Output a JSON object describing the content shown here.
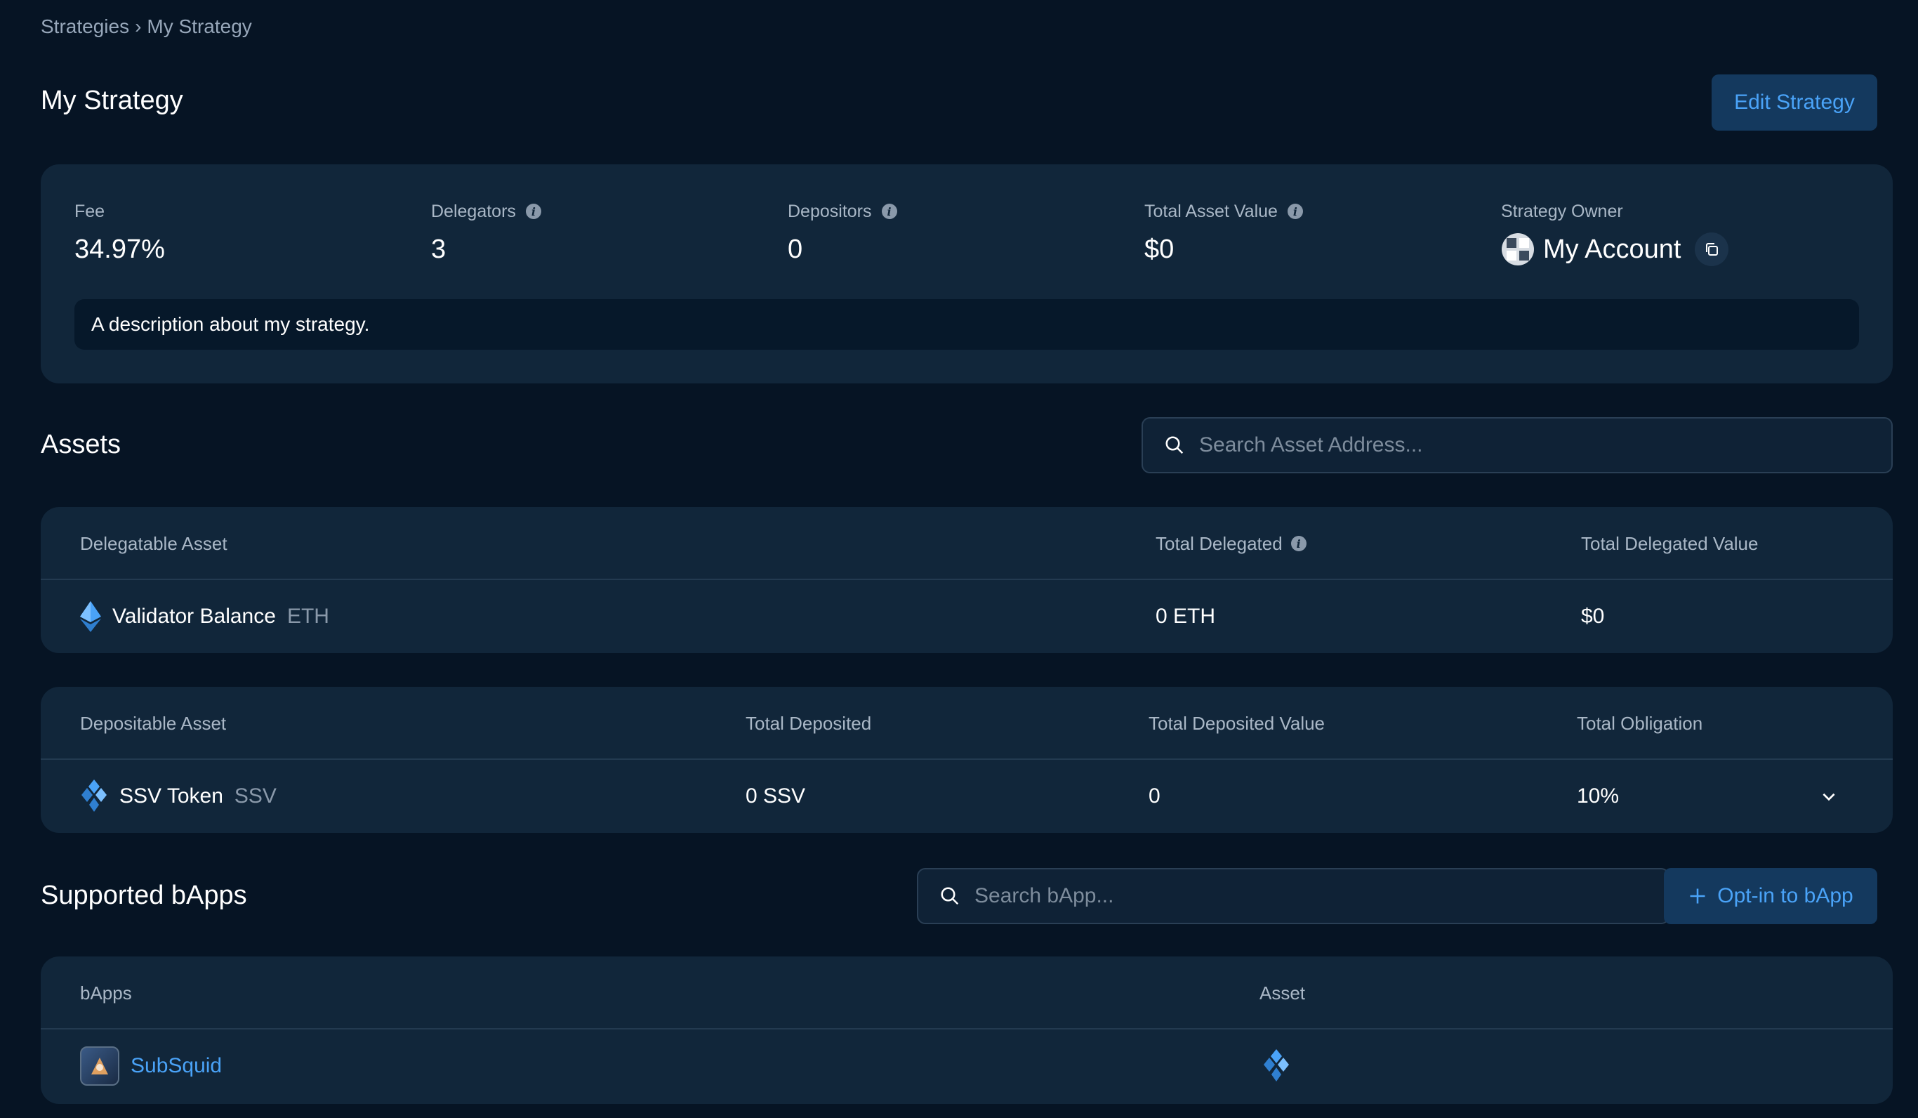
{
  "breadcrumb": {
    "root": "Strategies",
    "separator": "›",
    "current": "My Strategy"
  },
  "header": {
    "title": "My Strategy",
    "edit_label": "Edit Strategy"
  },
  "stats": {
    "fee": {
      "label": "Fee",
      "value": "34.97%"
    },
    "delegators": {
      "label": "Delegators",
      "value": "3"
    },
    "depositors": {
      "label": "Depositors",
      "value": "0"
    },
    "total_asset_value": {
      "label": "Total Asset Value",
      "value": "$0"
    },
    "owner": {
      "label": "Strategy Owner",
      "value": "My Account"
    }
  },
  "description": "A description about my strategy.",
  "assets": {
    "title": "Assets",
    "search_placeholder": "Search Asset Address...",
    "delegatable": {
      "headers": [
        "Delegatable Asset",
        "Total Delegated",
        "Total Delegated Value"
      ],
      "rows": [
        {
          "name": "Validator Balance",
          "ticker": "ETH",
          "total": "0 ETH",
          "value": "$0"
        }
      ]
    },
    "depositable": {
      "headers": [
        "Depositable Asset",
        "Total Deposited",
        "Total Deposited Value",
        "Total Obligation"
      ],
      "rows": [
        {
          "name": "SSV Token",
          "ticker": "SSV",
          "total": "0 SSV",
          "value": "0",
          "obligation": "10%"
        }
      ]
    }
  },
  "bapps": {
    "title": "Supported bApps",
    "search_placeholder": "Search bApp...",
    "optin_label": "Opt-in to bApp",
    "headers": [
      "bApps",
      "Asset"
    ],
    "rows": [
      {
        "name": "SubSquid"
      }
    ]
  },
  "colors": {
    "background": "#061424",
    "card": "#11263a",
    "accent": "#4aa3f8",
    "button_bg": "#14395e"
  }
}
